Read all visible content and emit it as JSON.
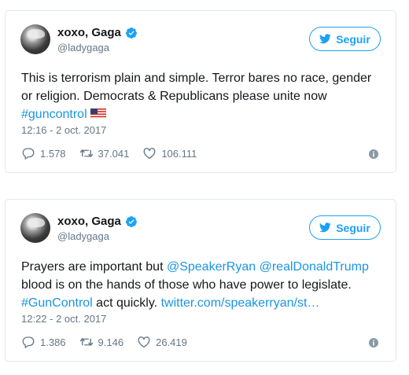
{
  "tweets": [
    {
      "name": "xoxo, Gaga",
      "handle": "@ladygaga",
      "follow_label": "Seguir",
      "text_plain": "This is terrorism plain and simple. Terror bares no race, gender or religion. Democrats & Republicans please unite now ",
      "hashtag": "#guncontrol",
      "flag": "US flag",
      "timestamp": "12:16 - 2 oct. 2017",
      "replies": "1.578",
      "retweets": "37.041",
      "likes": "106.111"
    },
    {
      "name": "xoxo, Gaga",
      "handle": "@ladygaga",
      "follow_label": "Seguir",
      "text_start": "Prayers are important but ",
      "mention1": "@SpeakerRyan",
      "mention2": "@realDonaldTrump",
      "text_mid": " blood is on the hands of those who have power to legislate. ",
      "hashtag": "#GunControl",
      "text_after_hashtag": " act quickly. ",
      "link": "twitter.com/speakerryan/st…",
      "timestamp": "12:22 - 2 oct. 2017",
      "replies": "1.386",
      "retweets": "9.146",
      "likes": "26.419"
    }
  ],
  "colors": {
    "accent": "#1da1f2",
    "link": "#1b95e0",
    "muted": "#657786",
    "border": "#e1e8ed"
  },
  "icons": [
    "verified-icon",
    "twitter-bird-icon",
    "reply-icon",
    "retweet-icon",
    "like-icon",
    "info-icon"
  ]
}
